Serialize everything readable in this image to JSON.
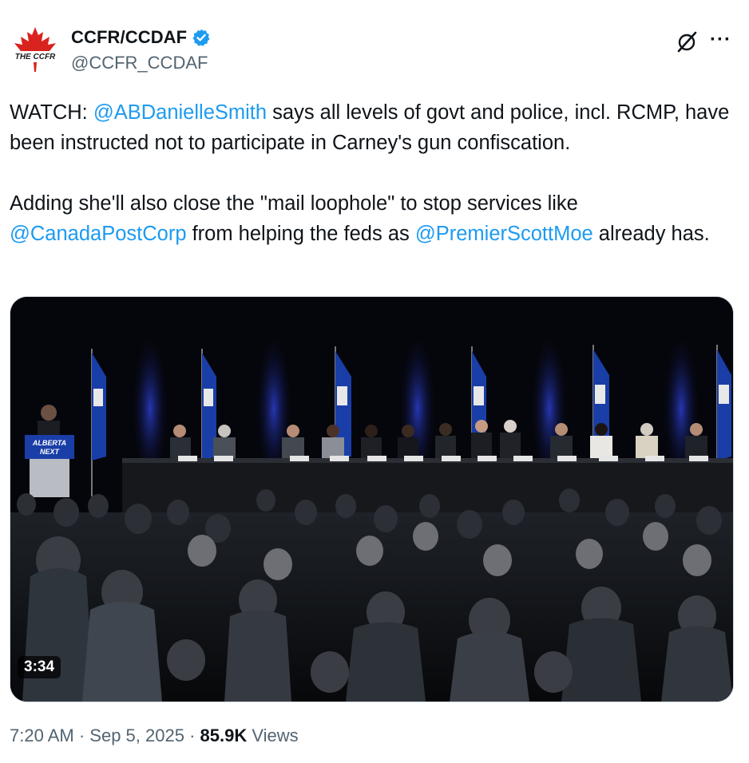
{
  "author": {
    "display_name": "CCFR/CCDAF",
    "handle": "@CCFR_CCDAF",
    "avatar_text": "THE CCFR"
  },
  "icons": {
    "verified": "verified-badge-icon",
    "grok": "grok-icon",
    "more": "more-icon"
  },
  "more_label": "···",
  "body": {
    "p1_prefix": "WATCH: ",
    "p1_mention": "@ABDanielleSmith",
    "p1_suffix": " says all levels of govt and police, incl. RCMP, have been instructed not to participate in Carney's gun confiscation.",
    "p2_prefix": "Adding she'll also close the \"mail loophole\" to stop services like ",
    "p2_mention1": "@CanadaPostCorp",
    "p2_middle": " from helping the feds as ",
    "p2_mention2": "@PremierScottMoe",
    "p2_suffix": " already has."
  },
  "media": {
    "podium_label_1": "ALBERTA",
    "podium_label_2": "NEXT",
    "duration": "3:34"
  },
  "meta": {
    "time": "7:20 AM",
    "sep": " · ",
    "date": "Sep 5, 2025",
    "views_count": "85.9K",
    "views_label": " Views"
  },
  "colors": {
    "mention": "#1d9bf0",
    "verified": "#1d9bf0",
    "secondary_text": "#536471",
    "primary_text": "#0f1419"
  }
}
